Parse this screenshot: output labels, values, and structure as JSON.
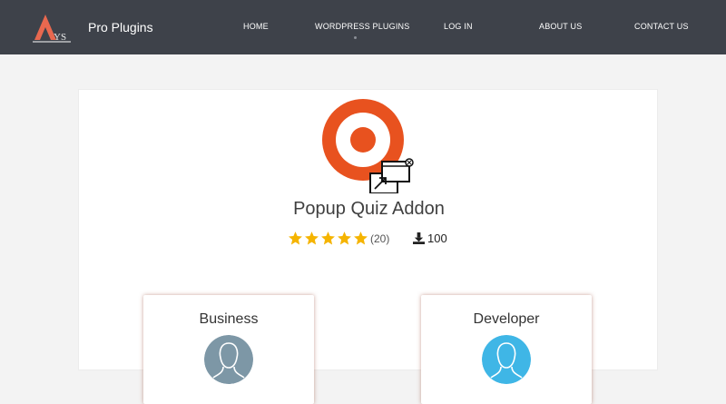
{
  "header": {
    "brand_name": "Pro Plugins",
    "brand_mark_text": "YS",
    "background_color": "#3e424a",
    "nav": [
      {
        "label": "HOME"
      },
      {
        "label": "WORDPRESS PLUGINS"
      },
      {
        "label": "LOG IN"
      },
      {
        "label": "ABOUT US"
      },
      {
        "label": "CONTACT US"
      }
    ]
  },
  "product": {
    "title": "Popup Quiz Addon",
    "icon": "target-popup-icon",
    "accent_color": "#e8521f",
    "rating": {
      "stars": 5,
      "count": "(20)"
    },
    "downloads": "100"
  },
  "plans": [
    {
      "name": "Business",
      "avatar_color": "#7d97a6"
    },
    {
      "name": "Developer",
      "avatar_color": "#3fb6e6"
    }
  ],
  "colors": {
    "star": "#f5b400",
    "card_shadow": "#a05a46"
  }
}
